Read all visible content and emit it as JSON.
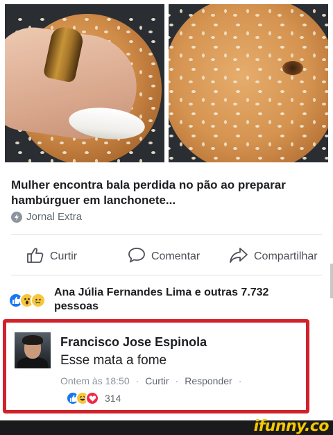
{
  "post": {
    "title": "Mulher encontra bala perdida no pão ao preparar hambúrguer em lanchonete...",
    "source": "Jornal Extra"
  },
  "actions": {
    "like": "Curtir",
    "comment": "Comentar",
    "share": "Compartilhar"
  },
  "reactions_summary": {
    "icons": [
      "like-reaction",
      "wow-reaction",
      "sad-reaction"
    ],
    "text": "Ana Júlia Fernandes Lima e outras 7.732 pessoas"
  },
  "comment": {
    "author": "Francisco Jose Espinola",
    "text": "Esse mata a fome",
    "time": "Ontem às 18:50",
    "separator": "·",
    "like_label": "Curtir",
    "reply_label": "Responder",
    "reaction_icons": [
      "like-reaction",
      "haha-reaction",
      "love-reaction"
    ],
    "reaction_count": "314",
    "highlight_color": "#d0222a"
  },
  "watermark": "ifunny.co",
  "colors": {
    "like_blue": "#1877f2",
    "reaction_yellow": "#f7c63d",
    "love_red": "#f0284a",
    "text_dark": "#1c1e21",
    "text_muted": "#8d949e"
  }
}
